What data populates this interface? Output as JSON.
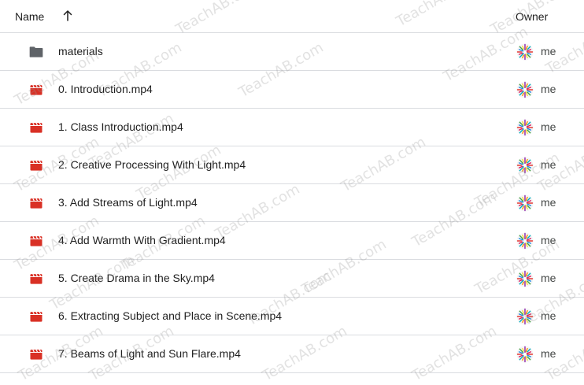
{
  "header": {
    "name_label": "Name",
    "owner_label": "Owner",
    "sort_direction": "ascending"
  },
  "files": [
    {
      "name": "materials",
      "type": "folder",
      "owner": "me"
    },
    {
      "name": "0. Introduction.mp4",
      "type": "video",
      "owner": "me"
    },
    {
      "name": "1. Class Introduction.mp4",
      "type": "video",
      "owner": "me"
    },
    {
      "name": "2. Creative Processing With Light.mp4",
      "type": "video",
      "owner": "me"
    },
    {
      "name": "3. Add Streams of Light.mp4",
      "type": "video",
      "owner": "me"
    },
    {
      "name": "4. Add Warmth With Gradient.mp4",
      "type": "video",
      "owner": "me"
    },
    {
      "name": "5. Create Drama in the Sky.mp4",
      "type": "video",
      "owner": "me"
    },
    {
      "name": "6. Extracting Subject and Place in Scene.mp4",
      "type": "video",
      "owner": "me"
    },
    {
      "name": "7. Beams of Light and Sun Flare.mp4",
      "type": "video",
      "owner": "me"
    }
  ],
  "watermark": "TeachAB.com",
  "colors": {
    "folder": "#5f6368",
    "video": "#d93025",
    "divider": "#dadce0"
  }
}
